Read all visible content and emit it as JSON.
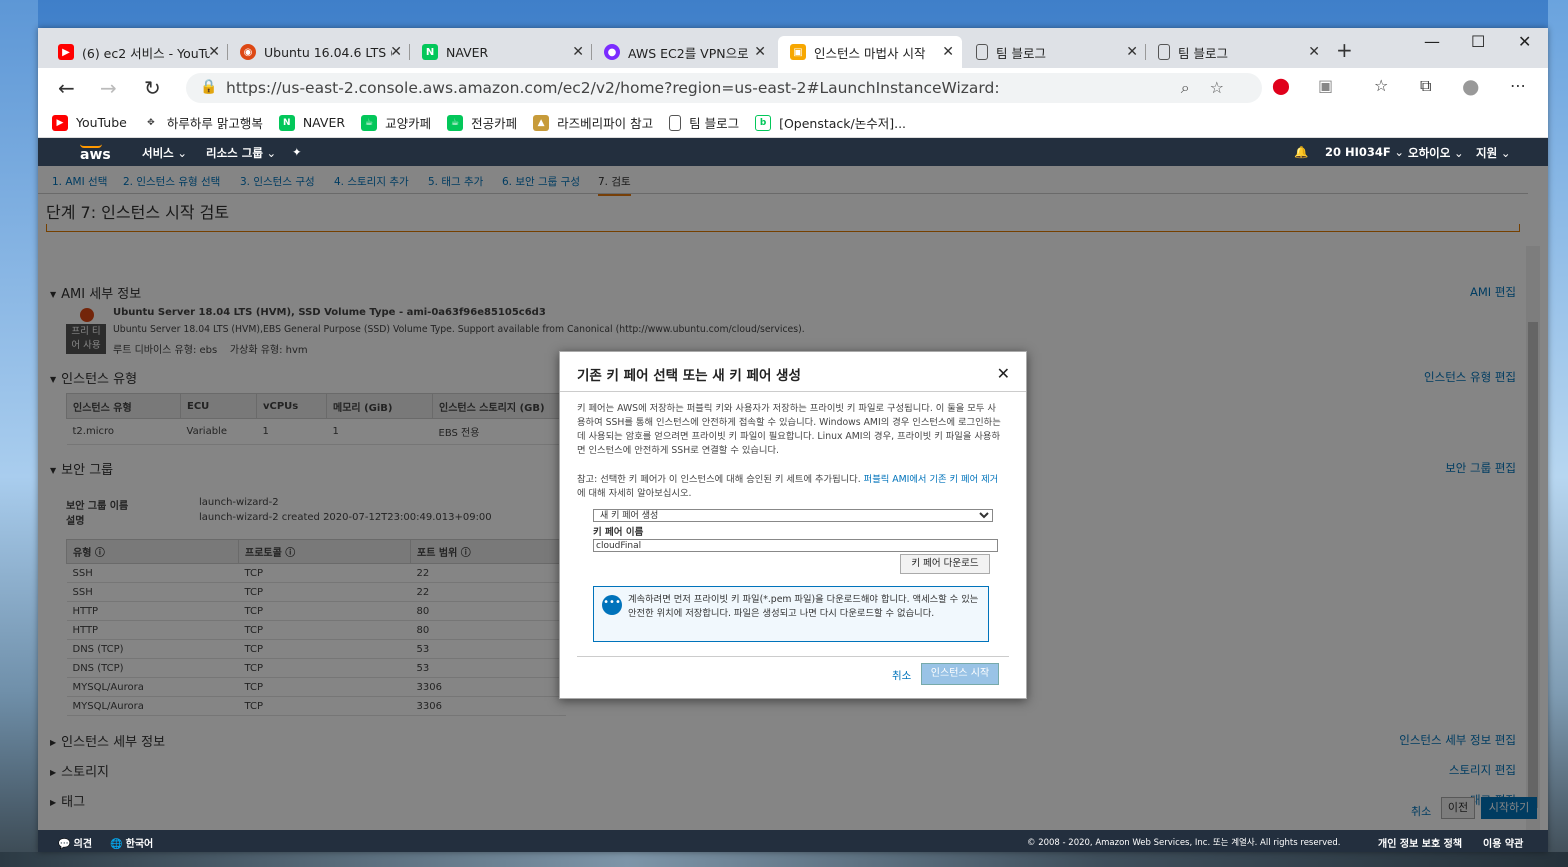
{
  "browser": {
    "tabs": [
      {
        "title": "(6) ec2 서비스 - YouTu",
        "icon": "youtube-icon",
        "color": "#ff0000"
      },
      {
        "title": "Ubuntu 16.04.6 LTS (X",
        "icon": "ubuntu-icon",
        "color": "#dd4814"
      },
      {
        "title": "NAVER",
        "icon": "naver-icon",
        "color": "#03c75a"
      },
      {
        "title": "AWS EC2를 VPN으로 ",
        "icon": "vpn-icon",
        "color": "#7b2cff"
      },
      {
        "title": "인스턴스 마법사 시작",
        "icon": "aws-icon",
        "color": "#f7a700"
      },
      {
        "title": "팀 블로그",
        "icon": "page-icon",
        "color": "#555555"
      },
      {
        "title": "팀 블로그",
        "icon": "page-icon",
        "color": "#555555"
      }
    ],
    "url": "https://us-east-2.console.aws.amazon.com/ec2/v2/home?region=us-east-2#LaunchInstanceWizard:",
    "bookmarks": [
      {
        "label": "YouTube",
        "color": "#ff0000",
        "glyph": "▶"
      },
      {
        "label": "하루하루 맑고행복",
        "color": "#333333",
        "glyph": "✥"
      },
      {
        "label": "NAVER",
        "color": "#03c75a",
        "glyph": "N"
      },
      {
        "label": "교양카페",
        "color": "#03c75a",
        "glyph": "☕"
      },
      {
        "label": "전공카페",
        "color": "#03c75a",
        "glyph": "☕"
      },
      {
        "label": "라즈베리파이 참고",
        "color": "#c79b3a",
        "glyph": "👷"
      },
      {
        "label": "팀 블로그",
        "color": "#666666",
        "glyph": "▯"
      },
      {
        "label": "[Openstack/논수저]...",
        "color": "#03c75a",
        "glyph": "b"
      }
    ]
  },
  "aws_nav": {
    "logo": "aws",
    "services": "서비스",
    "resource_groups": "리소스 그룹",
    "account": "20  HI034F",
    "region": "오하이오",
    "support": "지원"
  },
  "steps": [
    "1. AMI 선택",
    "2. 인스턴스 유형 선택",
    "3. 인스턴스 구성",
    "4. 스토리지 추가",
    "5. 태그 추가",
    "6. 보안 그룹 구성",
    "7. 검토"
  ],
  "page_title": "단계 7: 인스턴스 시작 검토",
  "ami": {
    "section": "AMI 세부 정보",
    "edit": "AMI 편집",
    "name": "Ubuntu Server 18.04 LTS (HVM), SSD Volume Type - ami-0a63f96e85105c6d3",
    "free_tier": "프리 티\n어 사용",
    "desc": "Ubuntu Server 18.04 LTS (HVM),EBS General Purpose (SSD) Volume Type. Support available from Canonical (http://www.ubuntu.com/cloud/services).",
    "root": "루트 디바이스 유형: ebs    가상화 유형: hvm"
  },
  "instance_type": {
    "section": "인스턴스 유형",
    "edit": "인스턴스 유형 편집",
    "headers": [
      "인스턴스 유형",
      "ECU",
      "vCPUs",
      "메모리 (GiB)",
      "인스턴스 스토리지 (GB)"
    ],
    "row": [
      "t2.micro",
      "Variable",
      "1",
      "1",
      "EBS 전용"
    ]
  },
  "security": {
    "section": "보안 그룹",
    "edit": "보안 그룹 편집",
    "name_label": "보안 그룹 이름",
    "name_value": "launch-wizard-2",
    "desc_label": "설명",
    "desc_value": "launch-wizard-2 created 2020-07-12T23:00:49.013+09:00",
    "headers": [
      "유형",
      "프로토콜",
      "포트 범위"
    ],
    "rows": [
      [
        "SSH",
        "TCP",
        "22"
      ],
      [
        "SSH",
        "TCP",
        "22"
      ],
      [
        "HTTP",
        "TCP",
        "80"
      ],
      [
        "HTTP",
        "TCP",
        "80"
      ],
      [
        "DNS (TCP)",
        "TCP",
        "53"
      ],
      [
        "DNS (TCP)",
        "TCP",
        "53"
      ],
      [
        "MYSQL/Aurora",
        "TCP",
        "3306"
      ],
      [
        "MYSQL/Aurora",
        "TCP",
        "3306"
      ]
    ]
  },
  "collapsed": [
    {
      "label": "인스턴스 세부 정보",
      "edit": "인스턴스 세부 정보 편집"
    },
    {
      "label": "스토리지",
      "edit": "스토리지 편집"
    },
    {
      "label": "태그",
      "edit": "태그 편집"
    }
  ],
  "footer_buttons": {
    "cancel": "취소",
    "prev": "이전",
    "launch": "시작하기"
  },
  "bottom": {
    "feedback": "의견",
    "language": "한국어",
    "copyright": "© 2008 - 2020, Amazon Web Services, Inc. 또는 계열사. All rights reserved.",
    "privacy": "개인 정보 보호 정책",
    "terms": "이용 약관"
  },
  "modal": {
    "title": "기존 키 페어 선택 또는 새 키 페어 생성",
    "para1": "키 페어는 AWS에 저장하는 퍼블릭 키와 사용자가 저장하는 프라이빗 키 파일로 구성됩니다. 이 둘을 모두 사용하여 SSH를 통해 인스턴스에 안전하게 접속할 수 있습니다. Windows AMI의 경우 인스턴스에 로그인하는 데 사용되는 암호를 얻으려면 프라이빗 키 파일이 필요합니다. Linux AMI의 경우, 프라이빗 키 파일을 사용하면 인스턴스에 안전하게 SSH로 연결할 수 있습니다.",
    "para2_prefix": "참고: 선택한 키 페어가 이 인스턴스에 대해 승인된 키 세트에 추가됩니다. ",
    "para2_link": "퍼블릭 AMI에서 기존 키 페어 제거",
    "para2_suffix": "에 대해 자세히 알아보십시오.",
    "select_value": "새 키 페어 생성",
    "keypair_label": "키 페어 이름",
    "keypair_value": "cloudFinal",
    "download": "키 페어 다운로드",
    "info": "계속하려면 먼저 프라이빗 키 파일(*.pem 파일)을 다운로드해야 합니다. 액세스할 수 있는 안전한 위치에 저장합니다. 파일은 생성되고 나면 다시 다운로드할 수 없습니다.",
    "cancel": "취소",
    "launch": "인스턴스 시작"
  }
}
